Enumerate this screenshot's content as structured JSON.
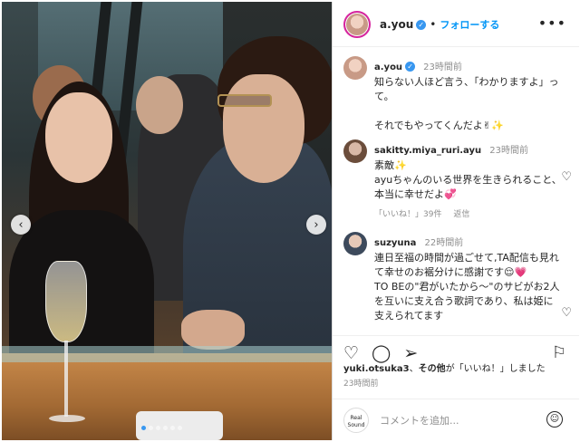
{
  "post": {
    "username": "a.you",
    "follow_label": "フォローする",
    "separator": "•",
    "more_icon": "more-horizontal-icon"
  },
  "carousel": {
    "total_slides": 6,
    "active_slide": 1
  },
  "caption": {
    "username": "a.you",
    "time": "23時間前",
    "text": "知らない人ほど言う、「わかりますよ」って。\n\nそれでもやってくんだよ✌✨"
  },
  "comments": [
    {
      "username": "sakitty.miya_ruri.ayu",
      "time": "23時間前",
      "text": "素敵✨\nayuちゃんのいる世界を生きられること、本当に幸せだよ💞",
      "like_label": "「いいね！」39件",
      "reply_label": "返信"
    },
    {
      "username": "suzyuna",
      "time": "22時間前",
      "text": "連日至福の時間が過ごせて,TA配信も見れて幸せのお裾分けに感謝です😌💗\nTO BEの\"君がいたから～\"のサビがお2人を互いに支え合う歌詞であり、私は姫に支えられてます"
    }
  ],
  "likes": {
    "user": "yuki.otsuka3",
    "suffix_bold": "その他",
    "suffix_text": "が「いいね！」しました"
  },
  "post_time": "23時間前",
  "add_comment": {
    "brand_line1": "Real",
    "brand_line2": "Sound",
    "placeholder": "コメントを追加..."
  }
}
